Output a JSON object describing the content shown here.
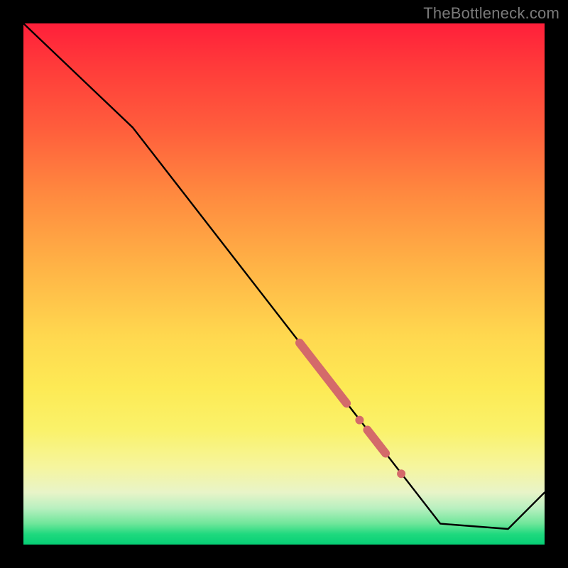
{
  "watermark": "TheBottleneck.com",
  "colors": {
    "line": "#000000",
    "highlight": "#d46a6a",
    "gradient_top": "#ff1f3a",
    "gradient_bottom": "#06cf75",
    "page_bg": "#000000"
  },
  "chart_data": {
    "type": "line",
    "title": "",
    "xlabel": "",
    "ylabel": "",
    "xlim": [
      0,
      100
    ],
    "ylim": [
      0,
      100
    ],
    "grid": false,
    "series": [
      {
        "name": "bottleneck-curve",
        "x": [
          0,
          21,
          80,
          93,
          100
        ],
        "y": [
          100,
          80,
          4,
          3,
          10
        ]
      }
    ],
    "highlights": [
      {
        "name": "segment-thick-1",
        "type": "segment",
        "x0": 53,
        "y0": 38.7,
        "x1": 62,
        "y1": 27.1,
        "weight": "thick"
      },
      {
        "name": "dot-1",
        "type": "dot",
        "x": 64.5,
        "y": 23.9
      },
      {
        "name": "segment-thick-2",
        "type": "segment",
        "x0": 66,
        "y0": 22.0,
        "x1": 69.5,
        "y1": 17.5,
        "weight": "thick"
      },
      {
        "name": "dot-2",
        "type": "dot",
        "x": 72.5,
        "y": 13.6
      }
    ]
  }
}
